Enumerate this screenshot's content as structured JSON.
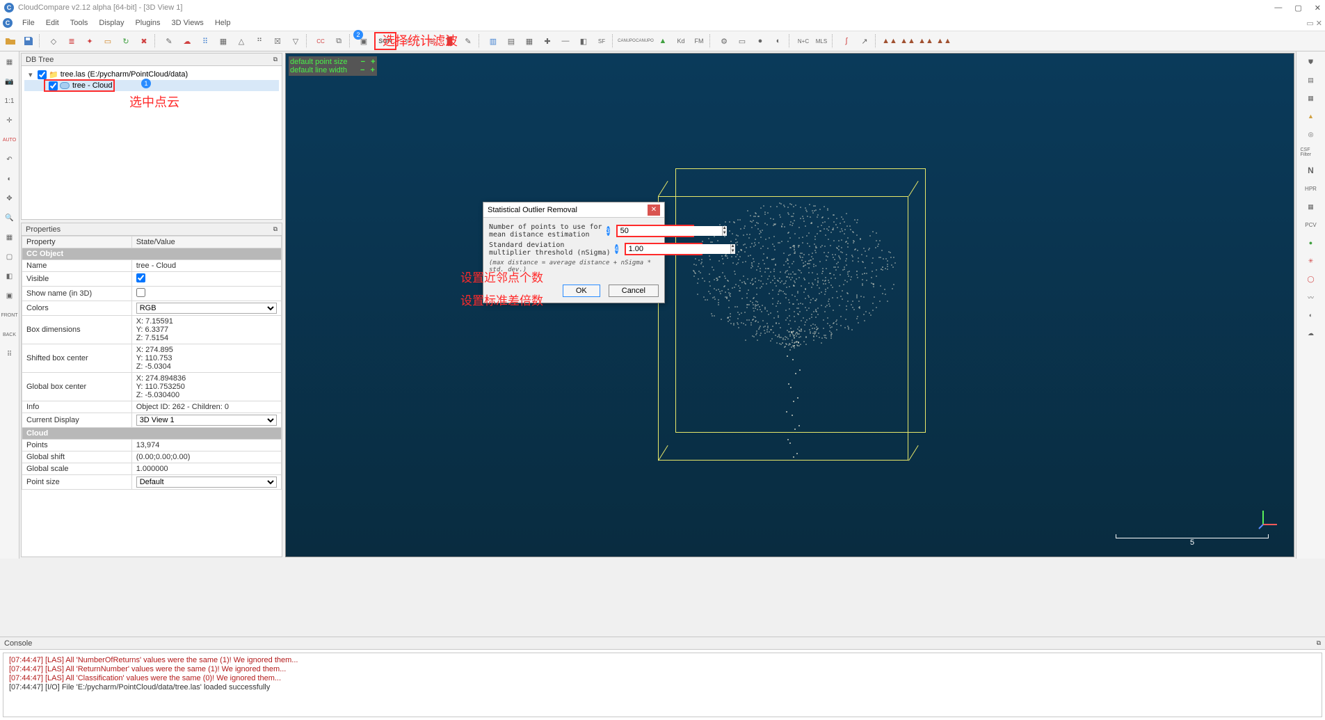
{
  "window": {
    "title": "CloudCompare v2.12 alpha [64-bit] - [3D View 1]"
  },
  "menu": {
    "items": [
      "File",
      "Edit",
      "Tools",
      "Display",
      "Plugins",
      "3D Views",
      "Help"
    ]
  },
  "annotations": {
    "top": "选择统计滤波",
    "select_cloud": "选中点云",
    "near_points": "设置近邻点个数",
    "std_times": "设置标准差倍数",
    "b1": "1",
    "b2": "2",
    "b3": "3",
    "b4": "4"
  },
  "toolbar_sor": "SOR",
  "left_labels": {
    "one_one": "1:1",
    "auto": "AUTO"
  },
  "right_labels": {
    "csf": "CSF Filter",
    "hpr": "HPR",
    "pcv": "PCV",
    "n": "N"
  },
  "dbtree": {
    "title": "DB Tree",
    "root": "tree.las (E:/pycharm/PointCloud/data)",
    "child": "tree - Cloud"
  },
  "viewport": {
    "point_size": "default point size",
    "line_width": "default line width",
    "scale": "5"
  },
  "properties": {
    "title": "Properties",
    "headers": [
      "Property",
      "State/Value"
    ],
    "section1": "CC Object",
    "rows1": [
      {
        "k": "Name",
        "v": "tree - Cloud"
      },
      {
        "k": "Visible",
        "v": "[x]"
      },
      {
        "k": "Show name (in 3D)",
        "v": "[ ]"
      },
      {
        "k": "Colors",
        "v": "RGB"
      },
      {
        "k": "Box dimensions",
        "v": "X: 7.15591\nY: 6.3377\nZ: 7.5154"
      },
      {
        "k": "Shifted box center",
        "v": "X: 274.895\nY: 110.753\nZ: -5.0304"
      },
      {
        "k": "Global box center",
        "v": "X: 274.894836\nY: 110.753250\nZ: -5.030400"
      },
      {
        "k": "Info",
        "v": "Object ID: 262 - Children: 0"
      },
      {
        "k": "Current Display",
        "v": "3D View 1"
      }
    ],
    "section2": "Cloud",
    "rows2": [
      {
        "k": "Points",
        "v": "13,974"
      },
      {
        "k": "Global shift",
        "v": "(0.00;0.00;0.00)"
      },
      {
        "k": "Global scale",
        "v": "1.000000"
      },
      {
        "k": "Point size",
        "v": "Default"
      }
    ]
  },
  "dialog": {
    "title": "Statistical Outlier Removal",
    "row1_label": "Number of points to use for\nmean distance estimation",
    "row1_value": "50",
    "row2_label": "Standard deviation\nmultiplier threshold (nSigma)",
    "row2_value": "1.00",
    "hint": "(max distance = average distance + nSigma * std. dev.)",
    "ok": "OK",
    "cancel": "Cancel"
  },
  "console": {
    "title": "Console",
    "lines": [
      {
        "t": "[07:44:47] [LAS] All 'NumberOfReturns' values were the same (1)! We ignored them...",
        "cls": "warn"
      },
      {
        "t": "[07:44:47] [LAS] All 'ReturnNumber' values were the same (1)! We ignored them...",
        "cls": "warn"
      },
      {
        "t": "[07:44:47] [LAS] All 'Classification' values were the same (0)! We ignored them...",
        "cls": "warn"
      },
      {
        "t": "[07:44:47] [I/O] File 'E:/pycharm/PointCloud/data/tree.las' loaded successfully",
        "cls": "info"
      }
    ]
  }
}
